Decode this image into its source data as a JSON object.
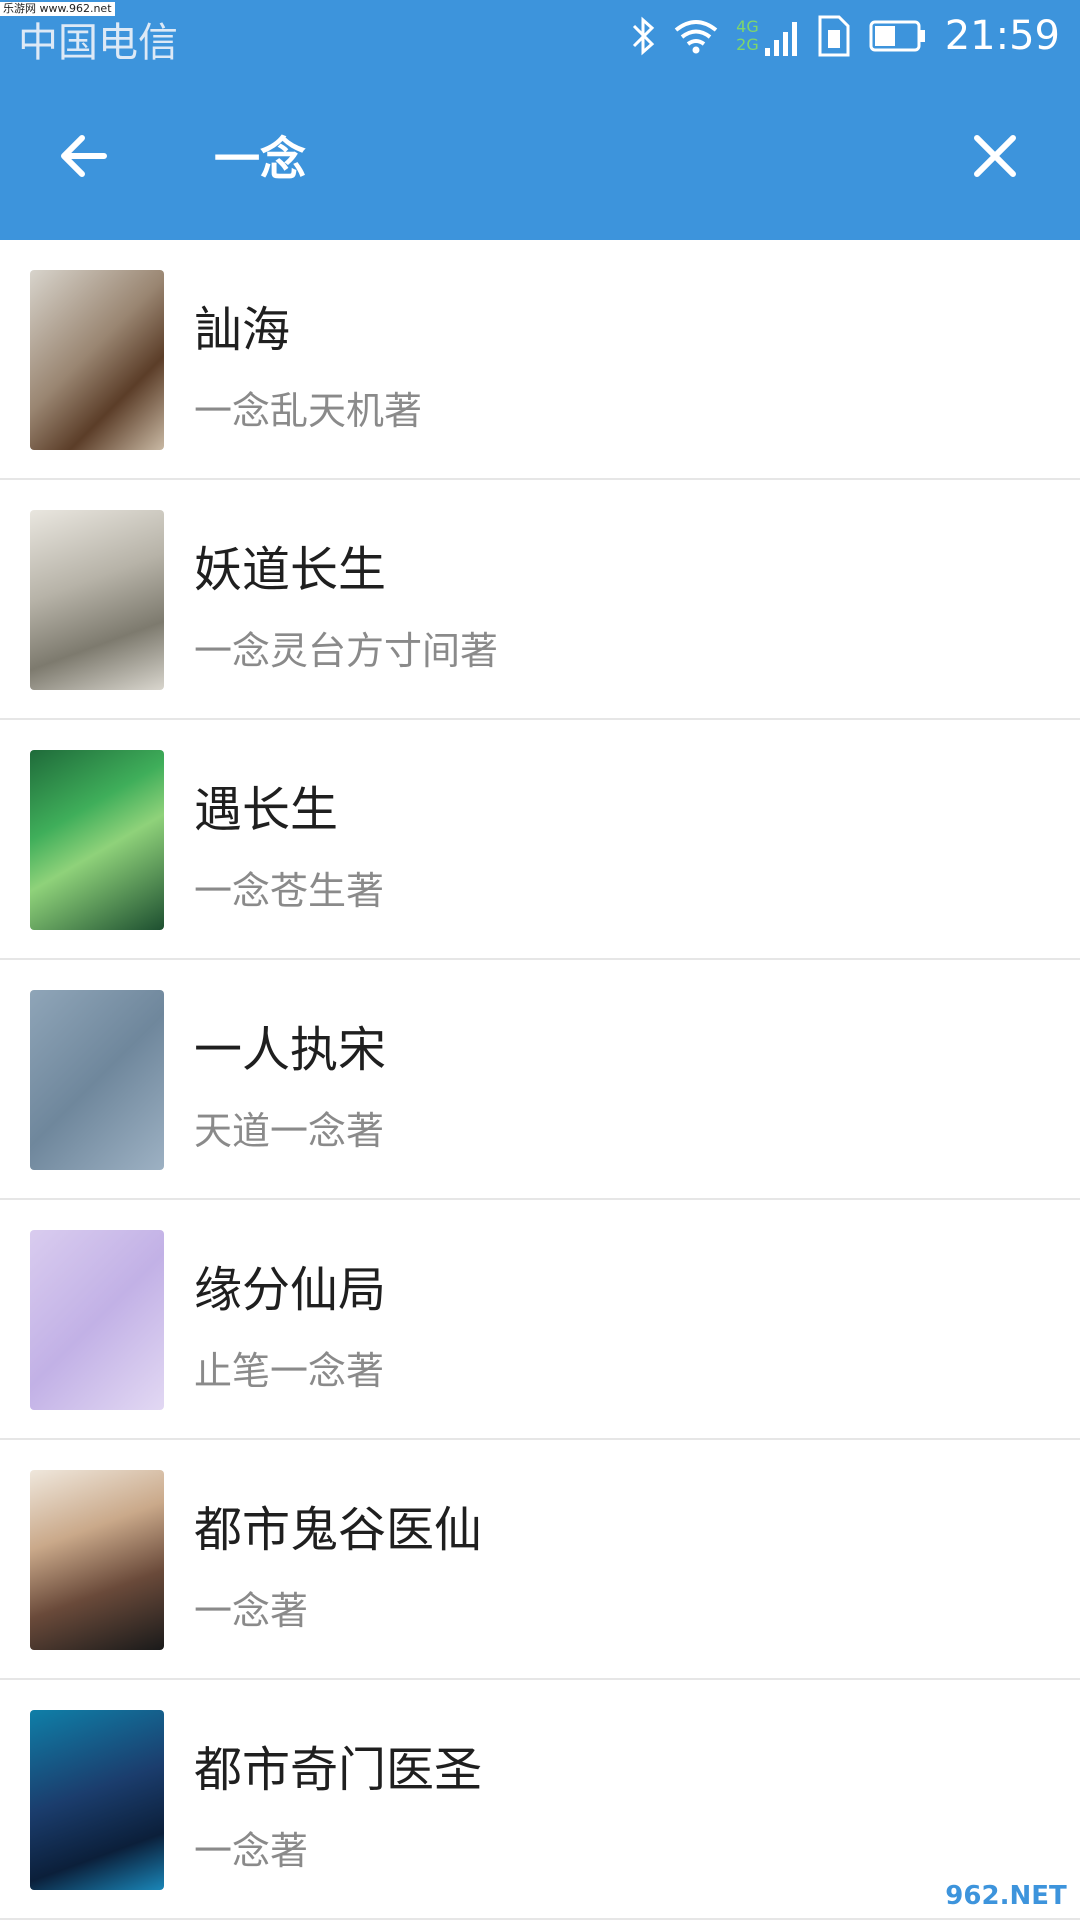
{
  "status_bar": {
    "carrier": "中国电信",
    "watermark": "乐游网 www.962.net",
    "network_top": "4G",
    "network_bottom": "2G",
    "time": "21:59"
  },
  "app_bar": {
    "search_value": "一念"
  },
  "results": [
    {
      "title": "訕海",
      "author": "一念乱天机著"
    },
    {
      "title": "妖道长生",
      "author": "一念灵台方寸间著"
    },
    {
      "title": "遇长生",
      "author": "一念苍生著"
    },
    {
      "title": "一人执宋",
      "author": "天道一念著"
    },
    {
      "title": "缘分仙局",
      "author": "止笔一念著"
    },
    {
      "title": "都市鬼谷医仙",
      "author": "一念著"
    },
    {
      "title": "都市奇门医圣",
      "author": "一念著"
    }
  ],
  "watermark_bottom": "962.NET",
  "colors": {
    "accent": "#3d94dc",
    "title_text": "#1f1f1f",
    "author_text": "#8a8a8a",
    "divider": "#e6e6e6"
  },
  "icons": {
    "bluetooth": "bluetooth-icon",
    "wifi": "wifi-icon",
    "signal": "signal-icon",
    "sim": "sim-card-icon",
    "battery": "battery-icon",
    "back": "arrow-left-icon",
    "clear": "close-icon"
  }
}
